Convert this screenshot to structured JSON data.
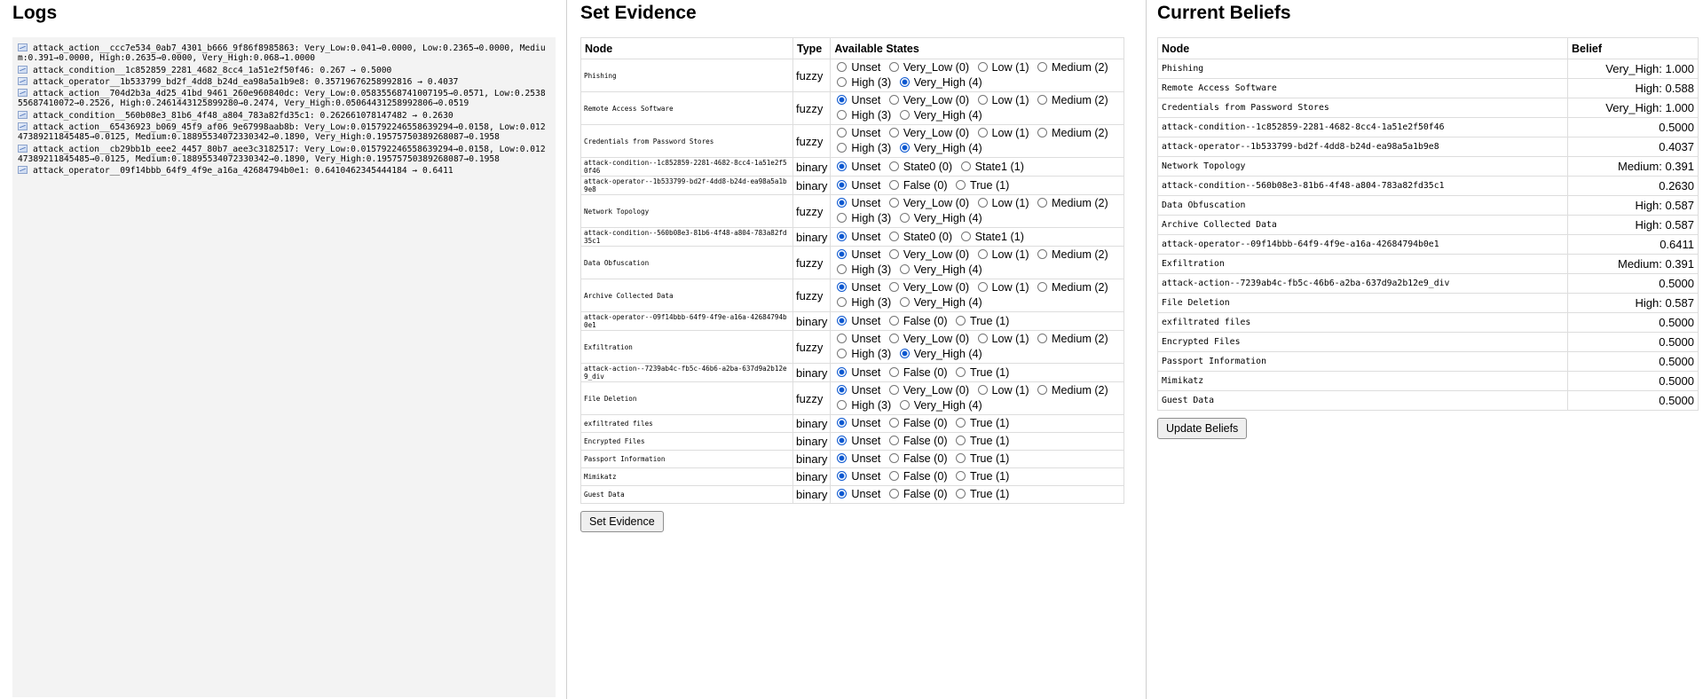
{
  "logs": {
    "title": "Logs",
    "lines": [
      "attack_action__ccc7e534_0ab7_4301_b666_9f86f8985863: Very_Low:0.041→0.0000, Low:0.2365→0.0000, Medium:0.391→0.0000, High:0.2635→0.0000, Very_High:0.068→1.0000",
      "attack_condition__1c852859_2281_4682_8cc4_1a51e2f50f46: 0.267 → 0.5000",
      "attack_operator__1b533799_bd2f_4dd8_b24d_ea98a5a1b9e8: 0.35719676258992816 → 0.4037",
      "attack_action__704d2b3a_4d25_41bd_9461_260e960840dc: Very_Low:0.05835568741007195→0.0571, Low:0.253855687410072→0.2526, High:0.2461443125899280→0.2474, Very_High:0.05064431258992806→0.0519",
      "attack_condition__560b08e3_81b6_4f48_a804_783a82fd35c1: 0.262661078147482 → 0.2630",
      "attack_action__65436923_b069_45f9_af06_9e67998aab8b: Very_Low:0.015792246558639294→0.0158, Low:0.01247389211845485→0.0125, Medium:0.18895534072330342→0.1890, Very_High:0.19575750389268087→0.1958",
      "attack_action__cb29bb1b_eee2_4457_80b7_aee3c3182517: Very_Low:0.015792246558639294→0.0158, Low:0.01247389211845485→0.0125, Medium:0.18895534072330342→0.1890, Very_High:0.19575750389268087→0.1958",
      "attack_operator__09f14bbb_64f9_4f9e_a16a_42684794b0e1: 0.6410462345444184 → 0.6411"
    ]
  },
  "evidence": {
    "title": "Set Evidence",
    "headers": [
      "Node",
      "Type",
      "Available States"
    ],
    "button": "Set Evidence",
    "rows": [
      {
        "node": "Phishing",
        "type": "fuzzy",
        "states": [
          "Unset",
          "Very_Low (0)",
          "Low (1)",
          "Medium (2)",
          "High (3)",
          "Very_High (4)"
        ],
        "selected": 5
      },
      {
        "node": "Remote Access Software",
        "type": "fuzzy",
        "states": [
          "Unset",
          "Very_Low (0)",
          "Low (1)",
          "Medium (2)",
          "High (3)",
          "Very_High (4)"
        ],
        "selected": 0
      },
      {
        "node": "Credentials from Password Stores",
        "type": "fuzzy",
        "states": [
          "Unset",
          "Very_Low (0)",
          "Low (1)",
          "Medium (2)",
          "High (3)",
          "Very_High (4)"
        ],
        "selected": 5
      },
      {
        "node": "attack-condition--1c852859-2281-4682-8cc4-1a51e2f50f46",
        "type": "binary",
        "states": [
          "Unset",
          "State0 (0)",
          "State1 (1)"
        ],
        "selected": 0
      },
      {
        "node": "attack-operator--1b533799-bd2f-4dd8-b24d-ea98a5a1b9e8",
        "type": "binary",
        "states": [
          "Unset",
          "False (0)",
          "True (1)"
        ],
        "selected": 0
      },
      {
        "node": "Network Topology",
        "type": "fuzzy",
        "states": [
          "Unset",
          "Very_Low (0)",
          "Low (1)",
          "Medium (2)",
          "High (3)",
          "Very_High (4)"
        ],
        "selected": 0
      },
      {
        "node": "attack-condition--560b08e3-81b6-4f48-a804-783a82fd35c1",
        "type": "binary",
        "states": [
          "Unset",
          "State0 (0)",
          "State1 (1)"
        ],
        "selected": 0
      },
      {
        "node": "Data Obfuscation",
        "type": "fuzzy",
        "states": [
          "Unset",
          "Very_Low (0)",
          "Low (1)",
          "Medium (2)",
          "High (3)",
          "Very_High (4)"
        ],
        "selected": 0
      },
      {
        "node": "Archive Collected Data",
        "type": "fuzzy",
        "states": [
          "Unset",
          "Very_Low (0)",
          "Low (1)",
          "Medium (2)",
          "High (3)",
          "Very_High (4)"
        ],
        "selected": 0
      },
      {
        "node": "attack-operator--09f14bbb-64f9-4f9e-a16a-42684794b0e1",
        "type": "binary",
        "states": [
          "Unset",
          "False (0)",
          "True (1)"
        ],
        "selected": 0
      },
      {
        "node": "Exfiltration",
        "type": "fuzzy",
        "states": [
          "Unset",
          "Very_Low (0)",
          "Low (1)",
          "Medium (2)",
          "High (3)",
          "Very_High (4)"
        ],
        "selected": 5
      },
      {
        "node": "attack-action--7239ab4c-fb5c-46b6-a2ba-637d9a2b12e9_div",
        "type": "binary",
        "states": [
          "Unset",
          "False (0)",
          "True (1)"
        ],
        "selected": 0
      },
      {
        "node": "File Deletion",
        "type": "fuzzy",
        "states": [
          "Unset",
          "Very_Low (0)",
          "Low (1)",
          "Medium (2)",
          "High (3)",
          "Very_High (4)"
        ],
        "selected": 0
      },
      {
        "node": "exfiltrated files",
        "type": "binary",
        "states": [
          "Unset",
          "False (0)",
          "True (1)"
        ],
        "selected": 0
      },
      {
        "node": "Encrypted Files",
        "type": "binary",
        "states": [
          "Unset",
          "False (0)",
          "True (1)"
        ],
        "selected": 0
      },
      {
        "node": "Passport Information",
        "type": "binary",
        "states": [
          "Unset",
          "False (0)",
          "True (1)"
        ],
        "selected": 0
      },
      {
        "node": "Mimikatz",
        "type": "binary",
        "states": [
          "Unset",
          "False (0)",
          "True (1)"
        ],
        "selected": 0
      },
      {
        "node": "Guest Data",
        "type": "binary",
        "states": [
          "Unset",
          "False (0)",
          "True (1)"
        ],
        "selected": 0
      }
    ]
  },
  "beliefs": {
    "title": "Current Beliefs",
    "headers": [
      "Node",
      "Belief"
    ],
    "button": "Update Beliefs",
    "rows": [
      {
        "node": "Phishing",
        "belief": "Very_High: 1.000"
      },
      {
        "node": "Remote Access Software",
        "belief": "High: 0.588"
      },
      {
        "node": "Credentials from Password Stores",
        "belief": "Very_High: 1.000"
      },
      {
        "node": "attack-condition--1c852859-2281-4682-8cc4-1a51e2f50f46",
        "belief": "0.5000"
      },
      {
        "node": "attack-operator--1b533799-bd2f-4dd8-b24d-ea98a5a1b9e8",
        "belief": "0.4037"
      },
      {
        "node": "Network Topology",
        "belief": "Medium: 0.391"
      },
      {
        "node": "attack-condition--560b08e3-81b6-4f48-a804-783a82fd35c1",
        "belief": "0.2630"
      },
      {
        "node": "Data Obfuscation",
        "belief": "High: 0.587"
      },
      {
        "node": "Archive Collected Data",
        "belief": "High: 0.587"
      },
      {
        "node": "attack-operator--09f14bbb-64f9-4f9e-a16a-42684794b0e1",
        "belief": "0.6411"
      },
      {
        "node": "Exfiltration",
        "belief": "Medium: 0.391"
      },
      {
        "node": "attack-action--7239ab4c-fb5c-46b6-a2ba-637d9a2b12e9_div",
        "belief": "0.5000"
      },
      {
        "node": "File Deletion",
        "belief": "High: 0.587"
      },
      {
        "node": "exfiltrated files",
        "belief": "0.5000"
      },
      {
        "node": "Encrypted Files",
        "belief": "0.5000"
      },
      {
        "node": "Passport Information",
        "belief": "0.5000"
      },
      {
        "node": "Mimikatz",
        "belief": "0.5000"
      },
      {
        "node": "Guest Data",
        "belief": "0.5000"
      }
    ]
  }
}
